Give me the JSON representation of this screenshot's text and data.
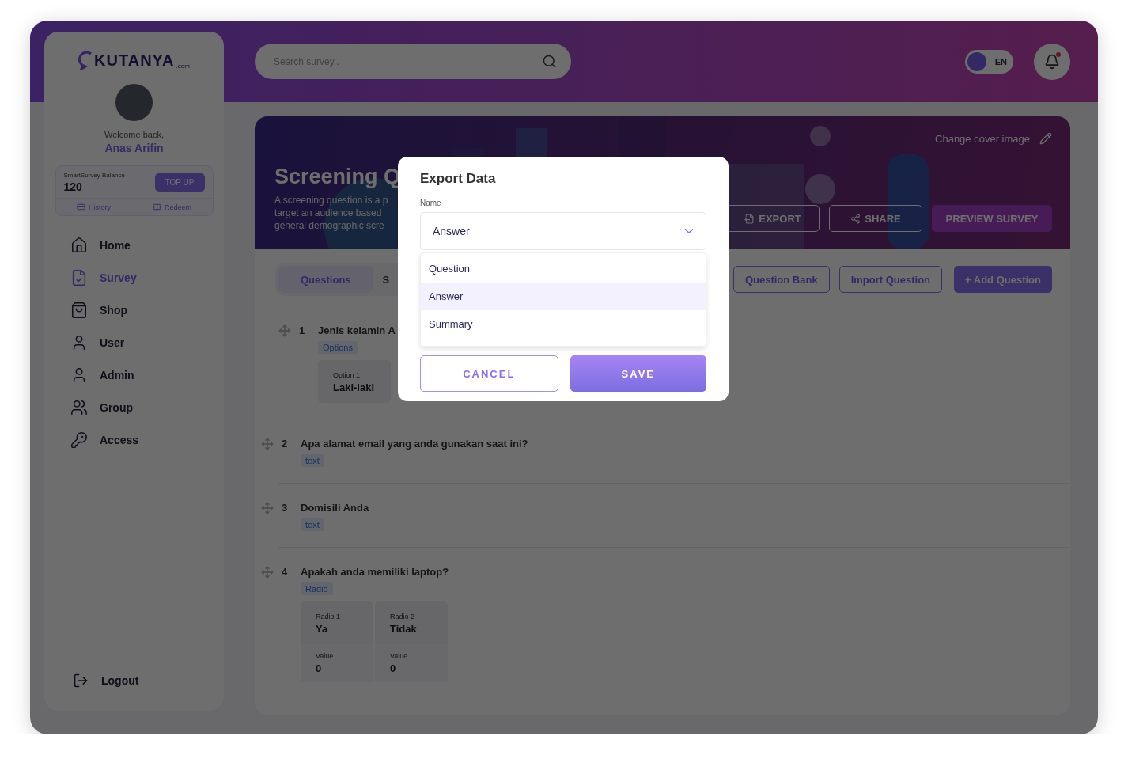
{
  "brand": {
    "name": "KUTANYA",
    "domain": ".com"
  },
  "user": {
    "greeting": "Welcome back,",
    "name": "Anas Arifin"
  },
  "balance": {
    "label": "SmartSurvey Balance",
    "amount": "120",
    "top_up": "TOP UP",
    "links": [
      "History",
      "Redeem"
    ]
  },
  "nav": [
    {
      "label": "Home",
      "kind": "home",
      "selected": false
    },
    {
      "label": "Survey",
      "kind": "survey",
      "selected": true
    },
    {
      "label": "Shop",
      "kind": "shop",
      "selected": false
    },
    {
      "label": "User",
      "kind": "user",
      "selected": false
    },
    {
      "label": "Admin",
      "kind": "user",
      "selected": false
    },
    {
      "label": "Group",
      "kind": "group",
      "selected": false
    },
    {
      "label": "Access",
      "kind": "key",
      "selected": false
    }
  ],
  "logout": "Logout",
  "search": {
    "placeholder": "Search survey.."
  },
  "language": {
    "label": "EN"
  },
  "cover": {
    "title": "Screening Q",
    "description": [
      "A screening question is a p",
      "target an audience based",
      "general demographic scre"
    ],
    "change_cover": "Change cover image",
    "actions": [
      {
        "label": "EXPORT",
        "kind": "export"
      },
      {
        "label": "SHARE",
        "kind": "share"
      },
      {
        "label": "PREVIEW SURVEY",
        "kind": "primary"
      }
    ]
  },
  "tabs": [
    {
      "label": "Questions",
      "selected": true
    },
    {
      "label": "S",
      "selected": false
    }
  ],
  "toolbar": [
    {
      "label": "Question Bank",
      "kind": "outline"
    },
    {
      "label": "Import Question",
      "kind": "outline"
    },
    {
      "label": "+ Add Question",
      "kind": "primary"
    }
  ],
  "questions": [
    {
      "number": "1",
      "text": "Jenis kelamin A",
      "type": "Options",
      "choices": [
        {
          "label": "Option 1",
          "value": "Laki-laki"
        }
      ]
    },
    {
      "number": "2",
      "text": "Apa alamat email yang anda gunakan saat ini?",
      "type": "text"
    },
    {
      "number": "3",
      "text": "Domisili Anda",
      "type": "text"
    },
    {
      "number": "4",
      "text": "Apakah anda memiliki laptop?",
      "type": "Radio",
      "choices": [
        {
          "label": "Radio 1",
          "value": "Ya",
          "score_label": "Value",
          "score": "0"
        },
        {
          "label": "Radio 2",
          "value": "Tidak",
          "score_label": "Value",
          "score": "0"
        }
      ]
    }
  ],
  "modal": {
    "title": "Export Data",
    "field_label": "Name",
    "value": "Answer",
    "options": [
      {
        "label": "Question",
        "selected": false
      },
      {
        "label": "Answer",
        "selected": true
      },
      {
        "label": "Summary",
        "selected": false
      }
    ],
    "cancel": "CANCEL",
    "save": "SAVE"
  }
}
